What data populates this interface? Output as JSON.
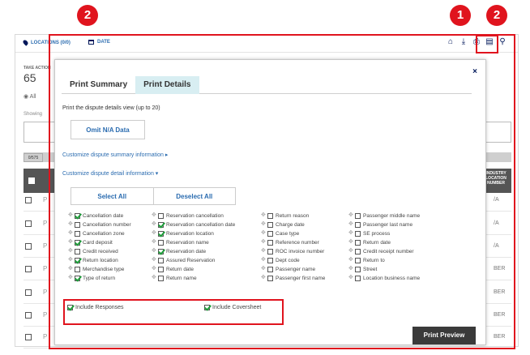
{
  "topbar": {
    "locations_label": "LOCATIONS (0/0)",
    "date_label": "DATE",
    "icons": [
      "home-icon",
      "download-icon",
      "print-icon",
      "document-icon",
      "search-icon"
    ]
  },
  "background": {
    "take_action_label": "TAKE ACTION",
    "take_action_count": "65",
    "radio_all_label": "All",
    "showing_label": "Showing",
    "row_count": "0/575",
    "industry_header": "INDUSTRY LOCATION NUMBER",
    "row_letter": "P",
    "row_right_values": [
      "/A",
      "/A",
      "/A",
      "BER",
      "BER",
      "BER",
      "BER"
    ]
  },
  "modal": {
    "tabs": [
      "Print Summary",
      "Print Details"
    ],
    "active_tab": "Print Details",
    "instruction": "Print the dispute details view (up to 20)",
    "omit_button": "Omit N/A Data",
    "customize_summary": "Customize dispute summary information",
    "customize_detail": "Customize dispute detail information",
    "select_all": "Select All",
    "deselect_all": "Deselect All",
    "columns": [
      [
        {
          "label": "Cancellation date",
          "checked": true
        },
        {
          "label": "Cancellation number",
          "checked": false
        },
        {
          "label": "Cancellation zone",
          "checked": false
        },
        {
          "label": "Card deposit",
          "checked": true
        },
        {
          "label": "Credit received",
          "checked": false
        },
        {
          "label": "Return location",
          "checked": true
        },
        {
          "label": "Merchandise type",
          "checked": false
        },
        {
          "label": "Type of return",
          "checked": true
        }
      ],
      [
        {
          "label": "Reservation cancellation",
          "checked": false
        },
        {
          "label": "Reservation cancellation date",
          "checked": true
        },
        {
          "label": "Reservation location",
          "checked": true
        },
        {
          "label": "Reservation name",
          "checked": false
        },
        {
          "label": "Reservation date",
          "checked": true
        },
        {
          "label": "Assured Reservation",
          "checked": false
        },
        {
          "label": "Return date",
          "checked": false
        },
        {
          "label": "Return name",
          "checked": false
        }
      ],
      [
        {
          "label": "Return reason",
          "checked": false
        },
        {
          "label": "Charge date",
          "checked": false
        },
        {
          "label": "Case type",
          "checked": false
        },
        {
          "label": "Reference number",
          "checked": false
        },
        {
          "label": "ROC invoice number",
          "checked": false
        },
        {
          "label": "Dept code",
          "checked": false
        },
        {
          "label": "Passenger name",
          "checked": false
        },
        {
          "label": "Passenger first name",
          "checked": false
        }
      ],
      [
        {
          "label": "Passenger middle name",
          "checked": false
        },
        {
          "label": "Passenger last name",
          "checked": false
        },
        {
          "label": "SE process",
          "checked": false
        },
        {
          "label": "Return date",
          "checked": false
        },
        {
          "label": "Credit receipt number",
          "checked": false
        },
        {
          "label": "Return to",
          "checked": false
        },
        {
          "label": "Street",
          "checked": false
        },
        {
          "label": "Location business name",
          "checked": false
        }
      ]
    ],
    "include_responses": "Include Responses",
    "include_coversheet": "Include Coversheet",
    "print_preview": "Print Preview"
  },
  "annotations": {
    "badge_left": "2",
    "badge_print": "1",
    "badge_right": "2",
    "color": "#e0141e"
  }
}
